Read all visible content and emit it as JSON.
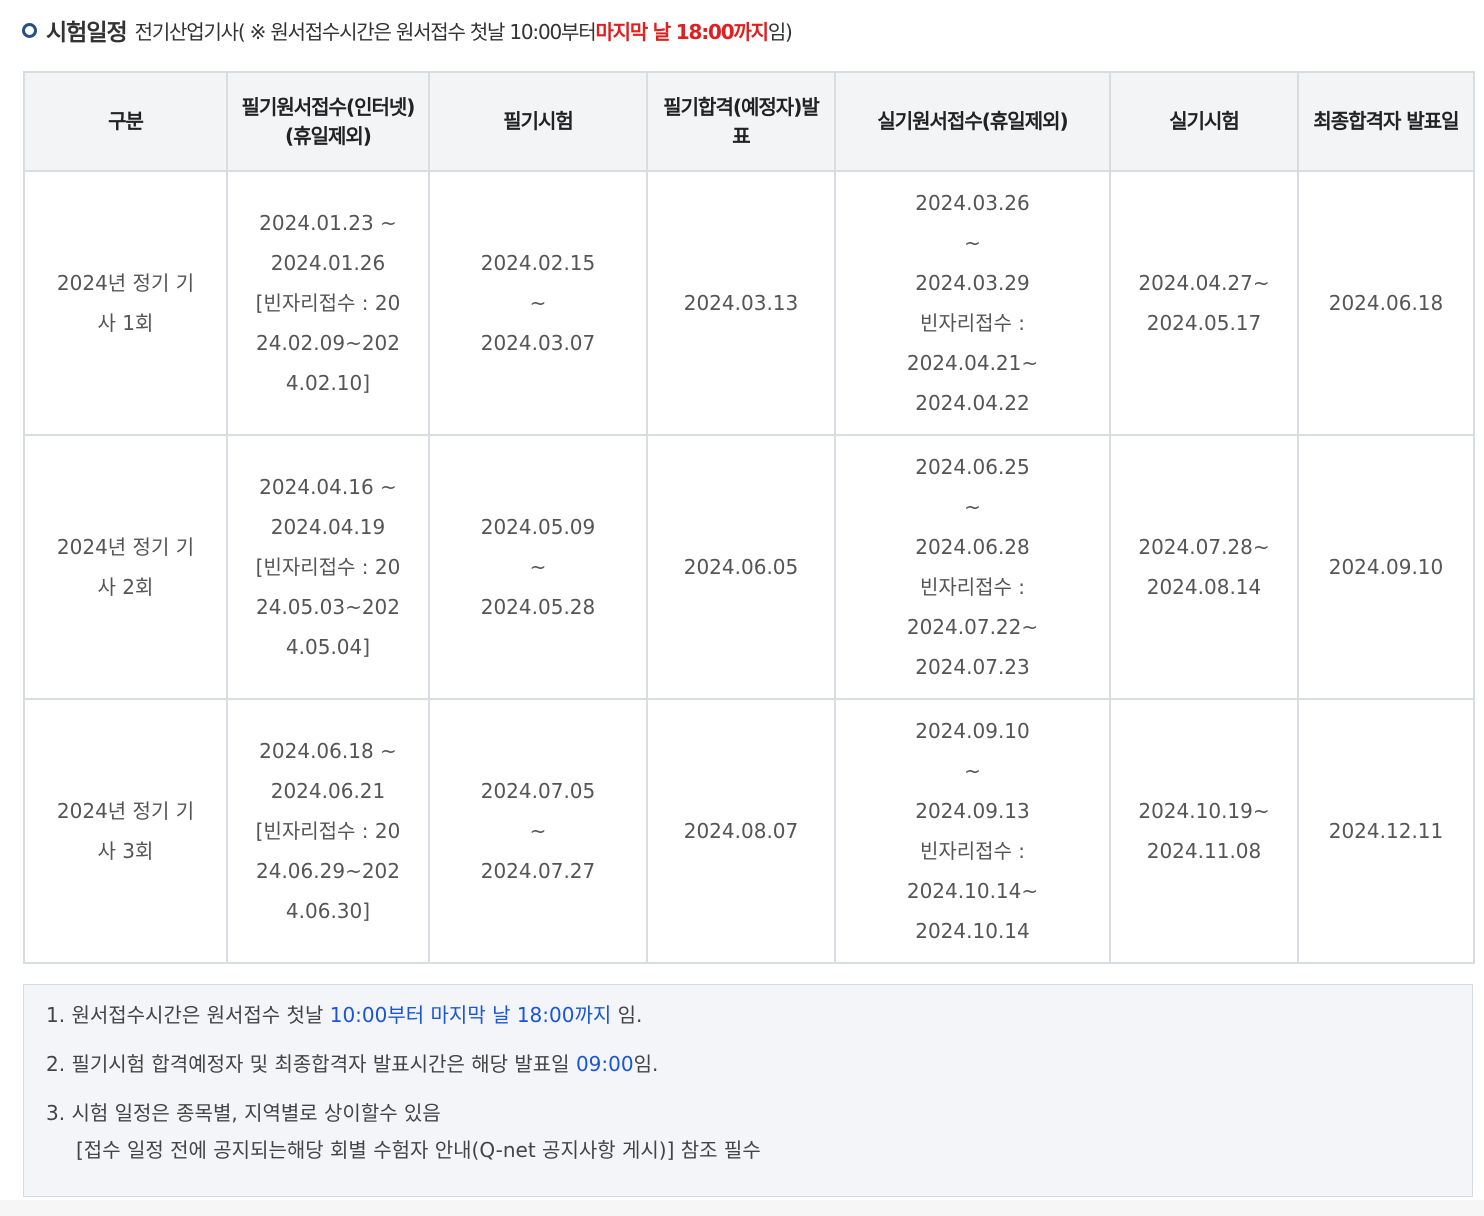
{
  "header": {
    "title": "시험일정",
    "subtitle_prefix": "전기산업기사( ※ 원서접수시간은 원서접수 첫날 10:00부터 ",
    "subtitle_highlight": "마지막 날 18:00까지",
    "subtitle_suffix": "임)",
    "highlight_color": "#e02020"
  },
  "table": {
    "headers": [
      "구분",
      "필기원서접수(인터넷)(휴일제외)",
      "필기시험",
      "필기합격(예정자)발표",
      "실기원서접수(휴일제외)",
      "실기시험",
      "최종합격자 발표일"
    ],
    "rows": [
      {
        "round": [
          "2024년 정기 기",
          "사 1회"
        ],
        "written_application": [
          "2024.01.23 ~",
          "2024.01.26",
          "[빈자리접수 : 20",
          "24.02.09~202",
          "4.02.10]"
        ],
        "written_exam": [
          "2024.02.15",
          "~",
          "2024.03.07"
        ],
        "written_result": [
          "2024.03.13"
        ],
        "practical_application": [
          "2024.03.26",
          "~",
          "2024.03.29",
          "빈자리접수 :",
          "2024.04.21~",
          "2024.04.22"
        ],
        "practical_exam": [
          "2024.04.27~",
          "2024.05.17"
        ],
        "final_result": [
          "2024.06.18"
        ]
      },
      {
        "round": [
          "2024년 정기 기",
          "사 2회"
        ],
        "written_application": [
          "2024.04.16 ~",
          "2024.04.19",
          "[빈자리접수 : 20",
          "24.05.03~202",
          "4.05.04]"
        ],
        "written_exam": [
          "2024.05.09",
          "~",
          "2024.05.28"
        ],
        "written_result": [
          "2024.06.05"
        ],
        "practical_application": [
          "2024.06.25",
          "~",
          "2024.06.28",
          "빈자리접수 :",
          "2024.07.22~",
          "2024.07.23"
        ],
        "practical_exam": [
          "2024.07.28~",
          "2024.08.14"
        ],
        "final_result": [
          "2024.09.10"
        ]
      },
      {
        "round": [
          "2024년 정기 기",
          "사 3회"
        ],
        "written_application": [
          "2024.06.18 ~",
          "2024.06.21",
          "[빈자리접수 : 20",
          "24.06.29~202",
          "4.06.30]"
        ],
        "written_exam": [
          "2024.07.05",
          "~",
          "2024.07.27"
        ],
        "written_result": [
          "2024.08.07"
        ],
        "practical_application": [
          "2024.09.10",
          "~",
          "2024.09.13",
          "빈자리접수 :",
          "2024.10.14~",
          "2024.10.14"
        ],
        "practical_exam": [
          "2024.10.19~",
          "2024.11.08"
        ],
        "final_result": [
          "2024.12.11"
        ]
      }
    ]
  },
  "notes": {
    "items": [
      {
        "prefix": "1. 원서접수시간은 원서접수 첫날 ",
        "highlight": "10:00부터 마지막 날 18:00까지",
        "suffix": " 임."
      },
      {
        "prefix": "2. 필기시험 합격예정자 및 최종합격자 발표시간은 해당 발표일 ",
        "highlight": "09:00",
        "suffix": "임."
      },
      {
        "prefix": "3. 시험 일정은 종목별, 지역별로 상이할수 있음",
        "highlight": "",
        "suffix": ""
      }
    ],
    "sub_note": "[접수 일정 전에 공지되는해당 회별 수험자 안내(Q-net 공지사항 게시)] 참조 필수",
    "highlight_color": "#1a56d6"
  }
}
